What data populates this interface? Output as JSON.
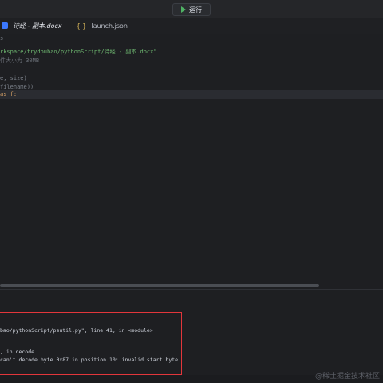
{
  "toolbar": {
    "run_label": "运行"
  },
  "tabs": [
    {
      "label": "诗经 - 副本.docx",
      "active": true
    },
    {
      "label": "launch.json",
      "active": false,
      "icon_text": "{ }"
    }
  ],
  "editor": {
    "lines": [
      {
        "text": "s",
        "color": "dim"
      },
      {
        "text": "rkspace/trydoubao/pythonScript/诗经 - 副本.docx\"",
        "color": "green"
      },
      {
        "text": "件大小为 30MB",
        "color": "comment"
      },
      {
        "text": "",
        "color": "text"
      },
      {
        "text": "e, size)",
        "color": "dim"
      },
      {
        "text": "filename))",
        "color": "dim"
      },
      {
        "text": "as f:",
        "color": "kw"
      }
    ]
  },
  "terminal": {
    "lines": [
      "bao/pythonScript/psutil.py\", line 41, in <module>",
      ", in decode",
      "can't decode byte 0x87 in position 10: invalid start byte"
    ]
  },
  "watermark": "@稀土掘金技术社区"
}
